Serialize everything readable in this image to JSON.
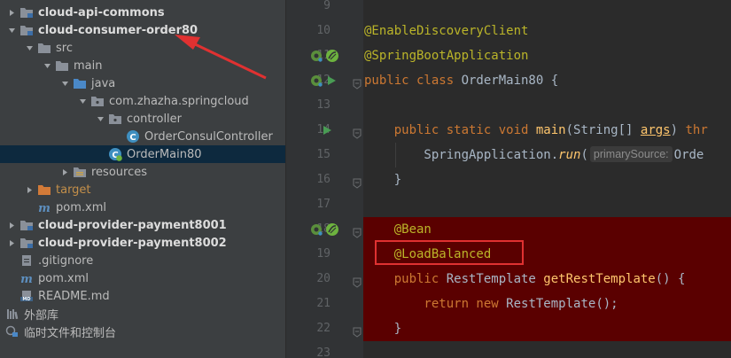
{
  "tree": [
    {
      "label": "cloud-api-commons",
      "indent": 0,
      "arrow": "right",
      "icon": "module-folder-icon",
      "bold": true
    },
    {
      "label": "cloud-consumer-order80",
      "indent": 0,
      "arrow": "down",
      "icon": "module-folder-icon",
      "bold": true
    },
    {
      "label": "src",
      "indent": 1,
      "arrow": "down",
      "icon": "folder-icon"
    },
    {
      "label": "main",
      "indent": 2,
      "arrow": "down",
      "icon": "folder-icon"
    },
    {
      "label": "java",
      "indent": 3,
      "arrow": "down",
      "icon": "source-folder-icon"
    },
    {
      "label": "com.zhazha.springcloud",
      "indent": 4,
      "arrow": "down",
      "icon": "package-icon"
    },
    {
      "label": "controller",
      "indent": 5,
      "arrow": "down",
      "icon": "package-icon"
    },
    {
      "label": "OrderConsulController",
      "indent": 6,
      "arrow": "none",
      "icon": "class-icon"
    },
    {
      "label": "OrderMain80",
      "indent": 5,
      "arrow": "none",
      "icon": "spring-boot-class-icon",
      "selected": true
    },
    {
      "label": "resources",
      "indent": 3,
      "arrow": "right",
      "icon": "resources-folder-icon"
    },
    {
      "label": "target",
      "indent": 1,
      "arrow": "right",
      "icon": "excluded-folder-icon",
      "orange": true
    },
    {
      "label": "pom.xml",
      "indent": 1,
      "arrow": "none",
      "icon": "maven-icon"
    },
    {
      "label": "cloud-provider-payment8001",
      "indent": 0,
      "arrow": "right",
      "icon": "module-folder-icon",
      "bold": true
    },
    {
      "label": "cloud-provider-payment8002",
      "indent": 0,
      "arrow": "right",
      "icon": "module-folder-icon",
      "bold": true
    },
    {
      "label": ".gitignore",
      "indent": 0,
      "arrow": "none",
      "icon": "ignore-file-icon"
    },
    {
      "label": "pom.xml",
      "indent": 0,
      "arrow": "none",
      "icon": "maven-icon"
    },
    {
      "label": "README.md",
      "indent": 0,
      "arrow": "none",
      "icon": "markdown-icon"
    },
    {
      "label": "外部库",
      "indent": -1,
      "arrow": "none",
      "icon": "library-icon"
    },
    {
      "label": "临时文件和控制台",
      "indent": -1,
      "arrow": "none",
      "icon": "scratch-icon"
    }
  ],
  "editor": {
    "lines": [
      {
        "num": "9",
        "code": []
      },
      {
        "num": "10",
        "code": [
          {
            "t": "@EnableDiscoveryClient",
            "c": "ann"
          }
        ]
      },
      {
        "num": "11",
        "gutter": [
          "spring-bean-icon",
          "run-spring-icon"
        ],
        "code": [
          {
            "t": "@SpringBootApplication",
            "c": "ann"
          }
        ]
      },
      {
        "num": "12",
        "gutter": [
          "spring-bean-icon",
          "run-icon"
        ],
        "code": [
          {
            "t": "public class ",
            "c": "kw"
          },
          {
            "t": "OrderMain80 ",
            "c": "ty"
          },
          {
            "t": "{",
            "c": ""
          }
        ]
      },
      {
        "num": "13",
        "code": []
      },
      {
        "num": "14",
        "gutter": [
          "run-icon"
        ],
        "code": [
          {
            "t": "    public static void ",
            "c": "kw"
          },
          {
            "t": "main",
            "c": "fn"
          },
          {
            "t": "(String[] ",
            "c": ""
          },
          {
            "t": "args",
            "c": "und"
          },
          {
            "t": ") ",
            "c": ""
          },
          {
            "t": "thr",
            "c": "kw"
          }
        ]
      },
      {
        "num": "15",
        "code": [
          {
            "t": "        SpringApplication.",
            "c": ""
          },
          {
            "t": "run",
            "c": "stat"
          },
          {
            "t": "(",
            "c": ""
          },
          {
            "t": "primarySource:",
            "c": "hint"
          },
          {
            "t": "Orde",
            "c": ""
          }
        ]
      },
      {
        "num": "16",
        "code": [
          {
            "t": "    }",
            "c": ""
          }
        ]
      },
      {
        "num": "17",
        "code": []
      },
      {
        "num": "18",
        "gutter": [
          "spring-bean-icon",
          "run-spring-icon"
        ],
        "hl": true,
        "code": [
          {
            "t": "    @Bean",
            "c": "ann"
          }
        ]
      },
      {
        "num": "19",
        "hl": true,
        "code": [
          {
            "t": "    @LoadBalanced",
            "c": "ann"
          }
        ]
      },
      {
        "num": "20",
        "hl": true,
        "code": [
          {
            "t": "    public ",
            "c": "kw"
          },
          {
            "t": "RestTemplate ",
            "c": "ty"
          },
          {
            "t": "getRestTemplate",
            "c": "fn"
          },
          {
            "t": "() {",
            "c": ""
          }
        ]
      },
      {
        "num": "21",
        "hl": true,
        "code": [
          {
            "t": "        return new ",
            "c": "kw"
          },
          {
            "t": "RestTemplate",
            "c": "ty"
          },
          {
            "t": "();",
            "c": ""
          }
        ]
      },
      {
        "num": "22",
        "hl": true,
        "code": [
          {
            "t": "    }",
            "c": ""
          }
        ]
      },
      {
        "num": "23",
        "code": []
      }
    ]
  },
  "colors": {
    "highlight": "#5a0000",
    "annotation_box": "#e03131",
    "arrow": "#e03131"
  }
}
